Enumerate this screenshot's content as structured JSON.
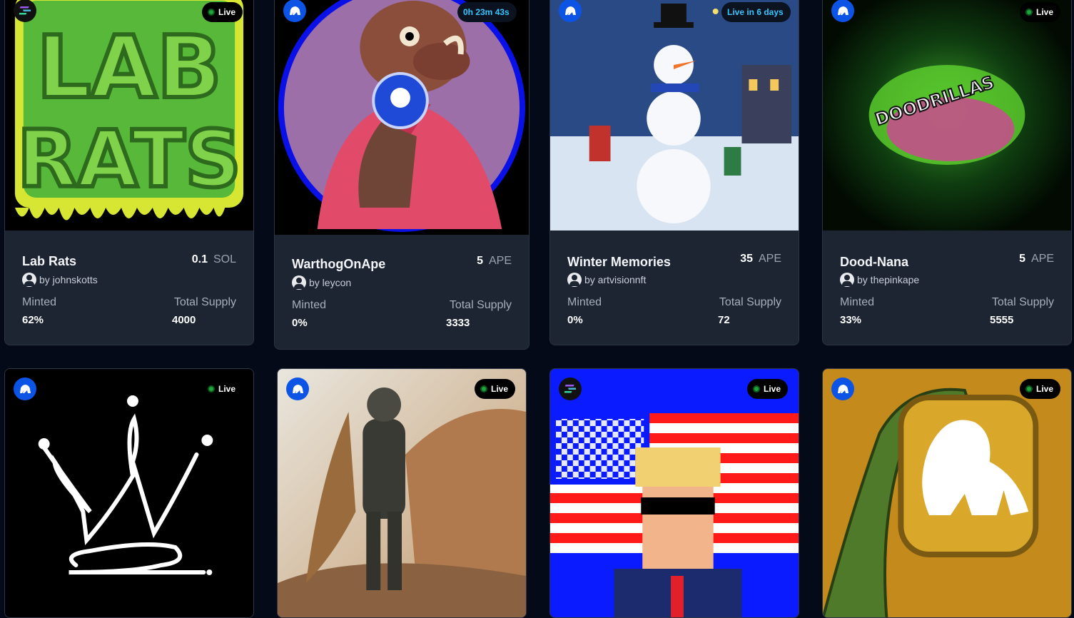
{
  "cards": [
    {
      "title": "Lab Rats",
      "price_amount": "0.1",
      "price_unit": "SOL",
      "creator": "by johnskotts",
      "minted_label": "Minted",
      "minted_value": "62%",
      "supply_label": "Total Supply",
      "supply_value": "4000",
      "status": "Live",
      "chain": "solana",
      "art_text": "LAB RATS"
    },
    {
      "title": "WarthogOnApe",
      "price_amount": "5",
      "price_unit": "APE",
      "creator": "by leycon",
      "minted_label": "Minted",
      "minted_value": "0%",
      "supply_label": "Total Supply",
      "supply_value": "3333",
      "status": "0h 23m 43s",
      "chain": "ape"
    },
    {
      "title": "Winter Memories",
      "price_amount": "35",
      "price_unit": "APE",
      "creator": "by artvisionnft",
      "minted_label": "Minted",
      "minted_value": "0%",
      "supply_label": "Total Supply",
      "supply_value": "72",
      "status": "Live in 6 days",
      "chain": "ape"
    },
    {
      "title": "Dood-Nana",
      "price_amount": "5",
      "price_unit": "APE",
      "creator": "by thepinkape",
      "minted_label": "Minted",
      "minted_value": "33%",
      "supply_label": "Total Supply",
      "supply_value": "5555",
      "status": "Live",
      "chain": "ape",
      "art_text": "DOODRILLAS"
    },
    {
      "status": "Live",
      "chain": "ape"
    },
    {
      "status": "Live",
      "chain": "ape"
    },
    {
      "status": "Live",
      "chain": "solana"
    },
    {
      "status": "Live",
      "chain": "ape"
    }
  ],
  "colors": {
    "background": "#050a18",
    "card": "#1d2432",
    "ape_blue": "#0c54e6",
    "live_green": "#1fa33c",
    "timer_cyan": "#37c6ff"
  }
}
